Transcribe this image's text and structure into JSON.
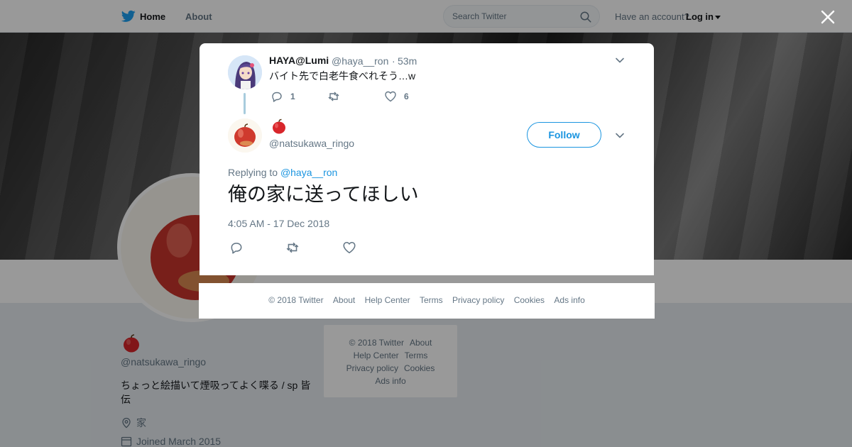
{
  "nav": {
    "home": "Home",
    "about": "About",
    "search_placeholder": "Search Twitter",
    "have_account": "Have an account?",
    "login": "Log in"
  },
  "profile": {
    "handle": "@natsukawa_ringo",
    "bio": "ちょっと絵描いて煙吸ってよく喋る / sp 皆伝",
    "location": "家",
    "joined": "Joined March 2015"
  },
  "side_footer": {
    "items": [
      "© 2018 Twitter",
      "About",
      "Help Center",
      "Terms",
      "Privacy policy",
      "Cookies",
      "Ads info"
    ]
  },
  "parent_tweet": {
    "name": "HAYA@Lumi",
    "handle": "@haya__ron",
    "dot": "·",
    "time": "53m",
    "text": "バイト先で白老牛食べれそう…w",
    "reply_count": "1",
    "retweet_count": "",
    "like_count": "6"
  },
  "main_tweet": {
    "handle": "@natsukawa_ringo",
    "follow_label": "Follow",
    "replying_prefix": "Replying to",
    "replying_to": "@haya__ron",
    "text": "俺の家に送ってほしい",
    "date": "4:05 AM - 17 Dec 2018"
  },
  "modal_footer": {
    "items": [
      "© 2018 Twitter",
      "About",
      "Help Center",
      "Terms",
      "Privacy policy",
      "Cookies",
      "Ads info"
    ]
  },
  "colors": {
    "accent": "#1b95e0",
    "twitter_blue": "#1da1f2",
    "muted": "#657786",
    "text": "#14171a"
  },
  "icons": {
    "logo": "twitter-bird-icon",
    "search": "search-icon",
    "close": "close-icon",
    "reply": "reply-icon",
    "retweet": "retweet-icon",
    "like": "heart-icon",
    "caret": "chevron-down-icon",
    "location": "location-pin-icon",
    "calendar": "calendar-icon",
    "apple": "apple-icon"
  }
}
